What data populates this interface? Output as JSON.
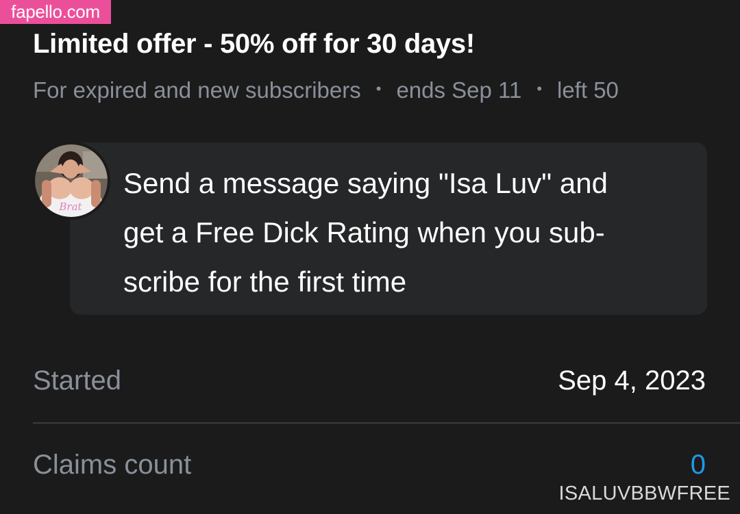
{
  "watermark": {
    "label": "fapello.com",
    "color": "#ec4f9a"
  },
  "offer": {
    "title": "Limited offer - 50% off for 30 days!",
    "audience": "For expired and new subscribers",
    "ends": "ends Sep 11",
    "remaining": "left 50",
    "separator": "•"
  },
  "message": {
    "avatar_icon": "profile-avatar",
    "avatar_badge_text": "Brat",
    "line1": "Send a message saying \"Isa Luv\" and",
    "line2": "get a Free Dick Rating when you sub-",
    "line3": "scribe for the first time"
  },
  "details": {
    "started_label": "Started",
    "started_value": "Sep 4, 2023",
    "claims_label": "Claims count",
    "claims_value": "0"
  },
  "footer": {
    "watermark": "ISALUVBBWFREE"
  },
  "colors": {
    "background": "#1b1b1c",
    "card": "#252728",
    "muted_text": "#8a9099",
    "accent": "#1f9ae6"
  }
}
